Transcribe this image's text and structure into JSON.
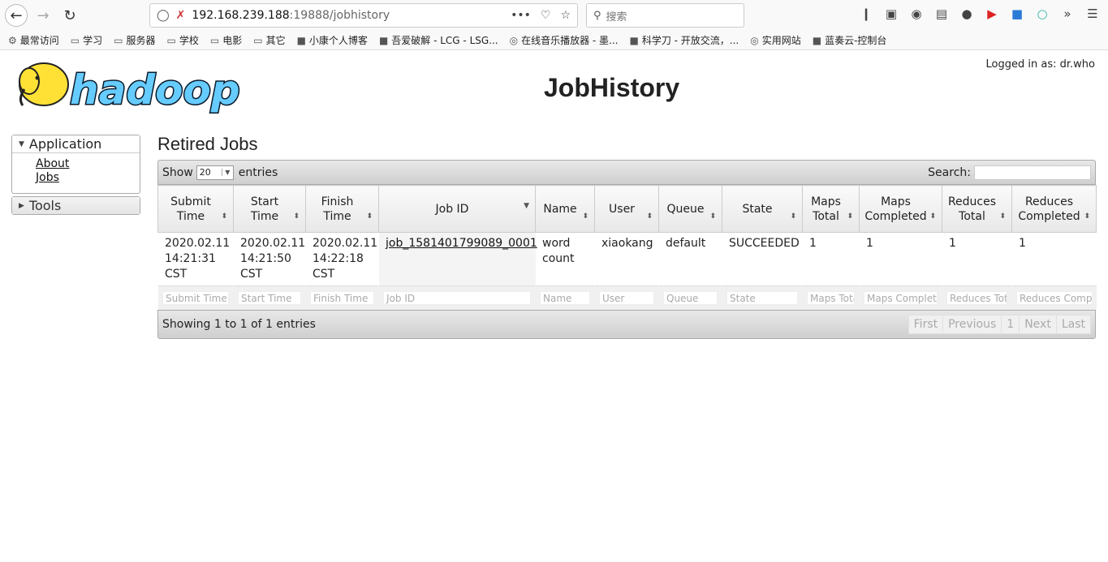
{
  "browser": {
    "url_host": "192.168.239.188",
    "url_rest": ":19888/jobhistory",
    "search_placeholder": "搜索",
    "menu_dots": "•••"
  },
  "bookmarks": [
    {
      "label": "最常访问",
      "icon": "gear-icon"
    },
    {
      "label": "学习",
      "icon": "folder-icon"
    },
    {
      "label": "服务器",
      "icon": "folder-icon"
    },
    {
      "label": "学校",
      "icon": "folder-icon"
    },
    {
      "label": "电影",
      "icon": "folder-icon"
    },
    {
      "label": "其它",
      "icon": "folder-icon"
    },
    {
      "label": "小康个人博客",
      "icon": "site-icon"
    },
    {
      "label": "吾爱破解 - LCG - LSG...",
      "icon": "site-icon"
    },
    {
      "label": "在线音乐播放器 - 墨...",
      "icon": "globe-icon"
    },
    {
      "label": "科学刀 - 开放交流，...",
      "icon": "site-icon"
    },
    {
      "label": "实用网站",
      "icon": "globe-icon"
    },
    {
      "label": "蓝奏云-控制台",
      "icon": "site-icon"
    }
  ],
  "header": {
    "logged_in": "Logged in as: dr.who",
    "title": "JobHistory",
    "logo_text": "hadoop"
  },
  "sidebar": {
    "application": "Application",
    "about": "About",
    "jobs": "Jobs",
    "tools": "Tools"
  },
  "main": {
    "heading": "Retired Jobs",
    "show": "Show",
    "length": "20",
    "entries": "entries",
    "search": "Search:",
    "info": "Showing 1 to 1 of 1 entries",
    "pager": [
      "First",
      "Previous",
      "1",
      "Next",
      "Last"
    ]
  },
  "table": {
    "columns": [
      "Submit Time",
      "Start Time",
      "Finish Time",
      "Job ID",
      "Name",
      "User",
      "Queue",
      "State",
      "Maps Total",
      "Maps Completed",
      "Reduces Total",
      "Reduces Completed"
    ],
    "filters": [
      "Submit Time",
      "Start Time",
      "Finish Time",
      "Job ID",
      "Name",
      "User",
      "Queue",
      "State",
      "Maps Total",
      "Maps Completed",
      "Reduces Total",
      "Reduces Completed"
    ],
    "rows": [
      [
        "2020.02.11 14:21:31 CST",
        "2020.02.11 14:21:50 CST",
        "2020.02.11 14:22:18 CST",
        "job_1581401799089_0001",
        "word count",
        "xiaokang",
        "default",
        "SUCCEEDED",
        "1",
        "1",
        "1",
        "1"
      ]
    ]
  }
}
